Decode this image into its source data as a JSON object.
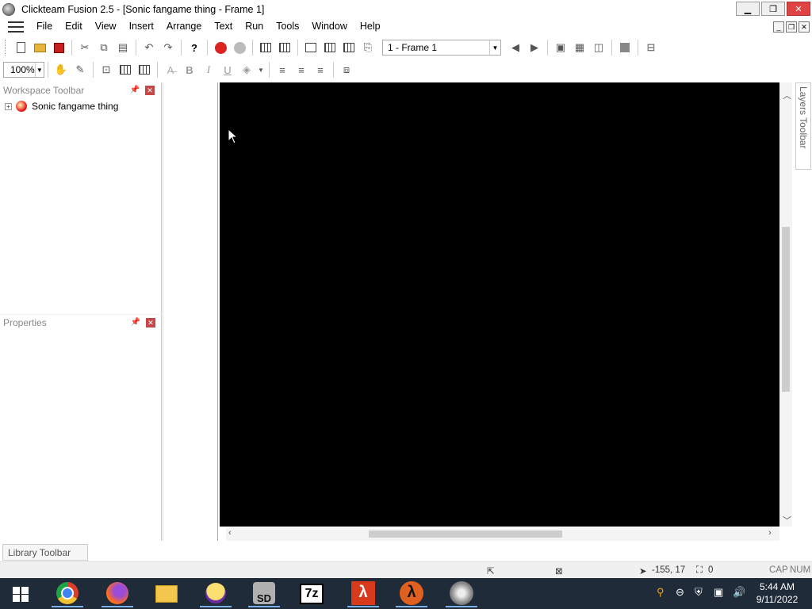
{
  "window": {
    "title": "Clickteam Fusion 2.5 - [Sonic fangame thing - Frame 1]"
  },
  "menu": [
    "File",
    "Edit",
    "View",
    "Insert",
    "Arrange",
    "Text",
    "Run",
    "Tools",
    "Window",
    "Help"
  ],
  "toolbar": {
    "frame_select": "1 - Frame 1",
    "zoom": "100%"
  },
  "workspace": {
    "title": "Workspace Toolbar",
    "project": "Sonic fangame thing"
  },
  "properties": {
    "title": "Properties"
  },
  "layers": {
    "title": "Layers Toolbar"
  },
  "library": {
    "title": "Library Toolbar"
  },
  "status": {
    "coords": "-155, 17",
    "count": "0",
    "caps": "CAP",
    "num": "NUM"
  },
  "clock": {
    "time": "5:44 AM",
    "date": "9/11/2022"
  },
  "icons": [
    "app-icon",
    "new-file-icon",
    "open-icon",
    "save-icon",
    "cut-icon",
    "copy-icon",
    "paste-icon",
    "undo-icon",
    "redo-icon",
    "help-icon",
    "back-icon",
    "forward-icon",
    "storyboard-icon",
    "frame-editor-icon",
    "event-editor-icon",
    "hand-icon",
    "grid-icon",
    "bold-icon",
    "italic-icon",
    "underline-icon",
    "align-left-icon",
    "align-center-icon",
    "align-right-icon",
    "windows-start-icon",
    "chrome-icon",
    "firefox-icon",
    "file-explorer-icon",
    "yahoo-icon",
    "sd-icon",
    "7zip-icon",
    "half-life-icon",
    "clickteam-icon",
    "search-icon",
    "volume-icon",
    "network-icon"
  ]
}
